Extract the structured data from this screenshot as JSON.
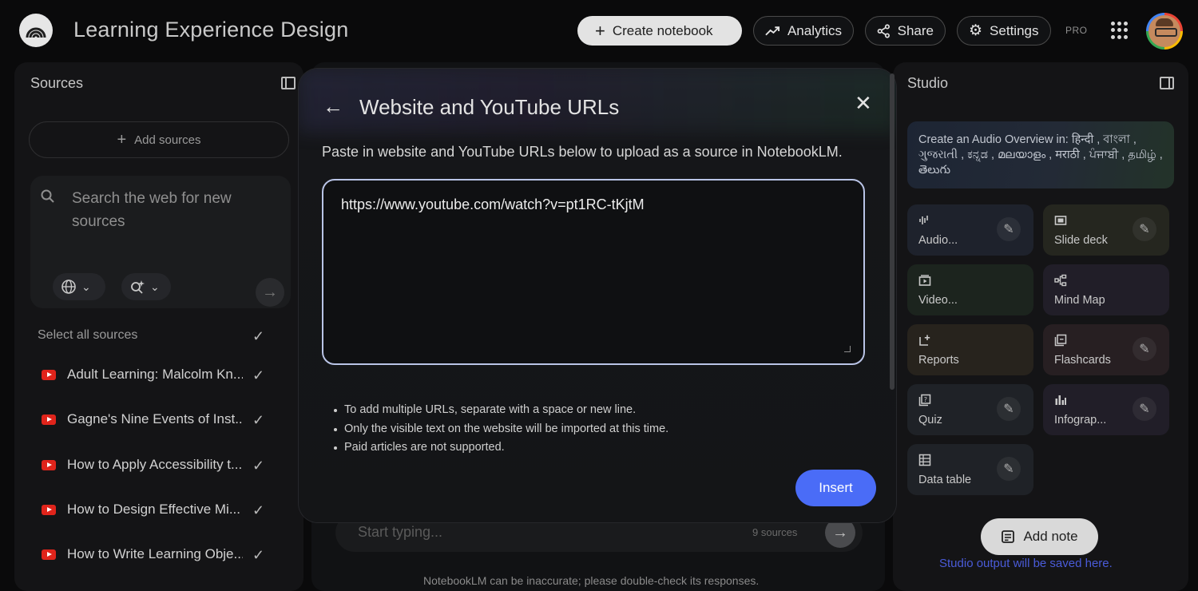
{
  "header": {
    "title": "Learning Experience Design",
    "create_label": "Create notebook",
    "analytics_label": "Analytics",
    "share_label": "Share",
    "settings_label": "Settings",
    "pro_label": "PRO"
  },
  "sources": {
    "title": "Sources",
    "add_label": "Add sources",
    "search_placeholder": "Search the web for new sources",
    "select_all_label": "Select all sources",
    "items": [
      {
        "label": "Adult Learning: Malcolm Kn..."
      },
      {
        "label": "Gagne's Nine Events of Inst..."
      },
      {
        "label": "How to Apply Accessibility t..."
      },
      {
        "label": "How to Design Effective Mi..."
      },
      {
        "label": "How to Write Learning Obje..."
      }
    ]
  },
  "chat": {
    "placeholder": "Start typing...",
    "source_count": "9 sources",
    "disclaimer": "NotebookLM can be inaccurate; please double-check its responses."
  },
  "modal": {
    "title": "Website and YouTube URLs",
    "description": "Paste in website and YouTube URLs below to upload as a source in NotebookLM.",
    "url_value": "https://www.youtube.com/watch?v=pt1RC-tKjtM",
    "notes": [
      "To add multiple URLs, separate with a space or new line.",
      "Only the visible text on the website will be imported at this time.",
      "Paid articles are not supported."
    ],
    "insert_label": "Insert"
  },
  "studio": {
    "title": "Studio",
    "audio_banner": "Create an Audio Overview in: हिन्दी , বাংলা , ગુજરાતી , ಕನ್ನಡ , മലയാളം , मराठी , ਪੰਜਾਬੀ , தமிழ் , తెలుగు",
    "tiles": [
      {
        "label": "Audio...",
        "icon": "waveform-icon"
      },
      {
        "label": "Slide deck",
        "icon": "slides-icon"
      },
      {
        "label": "Video...",
        "icon": "video-icon"
      },
      {
        "label": "Mind Map",
        "icon": "mind-map-icon"
      },
      {
        "label": "Reports",
        "icon": "reports-icon"
      },
      {
        "label": "Flashcards",
        "icon": "flashcards-icon"
      },
      {
        "label": "Quiz",
        "icon": "quiz-icon"
      },
      {
        "label": "Infograp...",
        "icon": "infographic-icon"
      },
      {
        "label": "Data table",
        "icon": "table-icon"
      }
    ],
    "add_note_label": "Add note",
    "output_hint": "Studio output will be saved here."
  },
  "colors": {
    "accent": "#4a6cf7",
    "background": "#0a0a0b",
    "youtube_red": "#e0241b"
  }
}
